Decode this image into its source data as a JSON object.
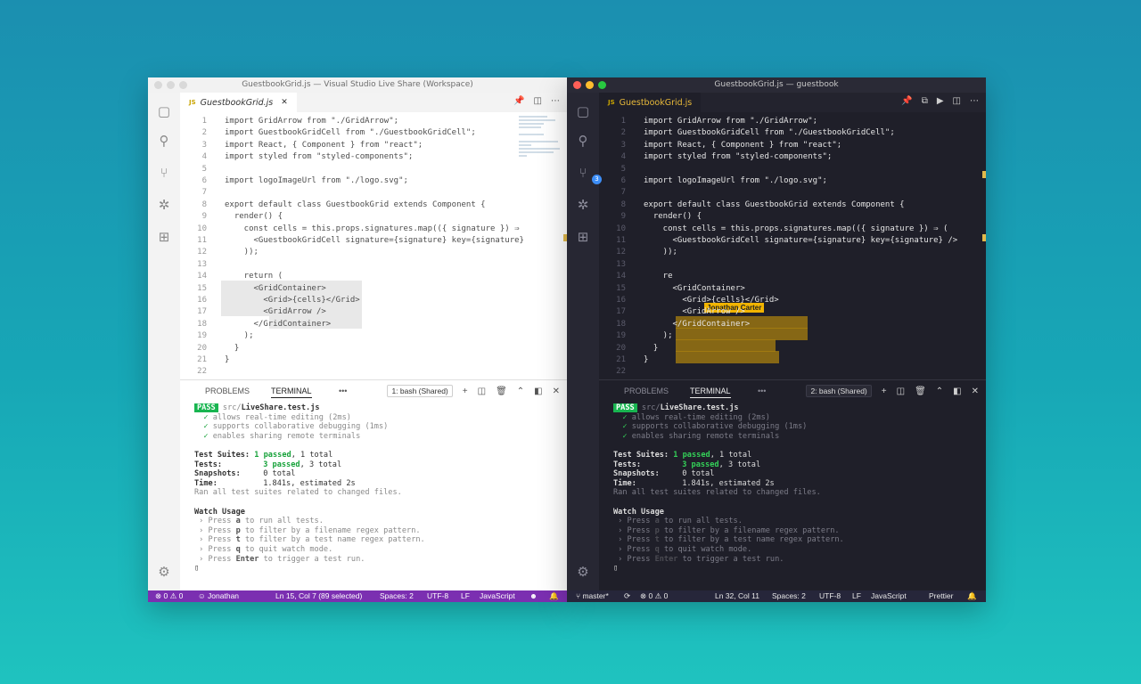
{
  "left": {
    "title": "GuestbookGrid.js — Visual Studio Live Share (Workspace)",
    "tab": {
      "icon": "JS",
      "label": "GuestbookGrid.js",
      "close": "✕"
    },
    "code": [
      {
        "n": "1",
        "t": "import GridArrow from \"./GridArrow\";"
      },
      {
        "n": "2",
        "t": "import GuestbookGridCell from \"./GuestbookGridCell\";"
      },
      {
        "n": "3",
        "t": "import React, { Component } from \"react\";"
      },
      {
        "n": "4",
        "t": "import styled from \"styled-components\";"
      },
      {
        "n": "5",
        "t": ""
      },
      {
        "n": "6",
        "t": "import logoImageUrl from \"./logo.svg\";"
      },
      {
        "n": "7",
        "t": ""
      },
      {
        "n": "8",
        "t": "export default class GuestbookGrid extends Component {"
      },
      {
        "n": "9",
        "t": "  render() {"
      },
      {
        "n": "10",
        "t": "    const cells = this.props.signatures.map(({ signature }) ⇒"
      },
      {
        "n": "11",
        "t": "      <GuestbookGridCell signature={signature} key={signature}"
      },
      {
        "n": "12",
        "t": "    ));"
      },
      {
        "n": "13",
        "t": ""
      },
      {
        "n": "14",
        "t": "    return ("
      },
      {
        "n": "15",
        "t": "      <GridContainer>"
      },
      {
        "n": "16",
        "t": "        <Grid>{cells}</Grid>"
      },
      {
        "n": "17",
        "t": "        <GridArrow />"
      },
      {
        "n": "18",
        "t": "      </GridContainer>"
      },
      {
        "n": "19",
        "t": "    );"
      },
      {
        "n": "20",
        "t": "  }"
      },
      {
        "n": "21",
        "t": "}"
      },
      {
        "n": "22",
        "t": ""
      }
    ],
    "panel": {
      "problems": "PROBLEMS",
      "terminal": "TERMINAL",
      "more": "•••",
      "select": "1: bash (Shared)"
    },
    "status": {
      "errors": "0",
      "warnings": "0",
      "user": "Jonathan",
      "position": "Ln 15, Col 7 (89 selected)",
      "spaces": "Spaces: 2",
      "encoding": "UTF-8",
      "eol": "LF",
      "language": "JavaScript"
    }
  },
  "right": {
    "title": "GuestbookGrid.js — guestbook",
    "tab": {
      "icon": "JS",
      "label": "GuestbookGrid.js"
    },
    "badge": "3",
    "collaborator": "Jonathan Carter",
    "code": [
      {
        "n": "1",
        "t": "import GridArrow from \"./GridArrow\";"
      },
      {
        "n": "2",
        "t": "import GuestbookGridCell from \"./GuestbookGridCell\";"
      },
      {
        "n": "3",
        "t": "import React, { Component } from \"react\";"
      },
      {
        "n": "4",
        "t": "import styled from \"styled-components\";"
      },
      {
        "n": "5",
        "t": ""
      },
      {
        "n": "6",
        "t": "import logoImageUrl from \"./logo.svg\";"
      },
      {
        "n": "7",
        "t": ""
      },
      {
        "n": "8",
        "t": "export default class GuestbookGrid extends Component {"
      },
      {
        "n": "9",
        "t": "  render() {"
      },
      {
        "n": "10",
        "t": "    const cells = this.props.signatures.map(({ signature }) ⇒ ("
      },
      {
        "n": "11",
        "t": "      <GuestbookGridCell signature={signature} key={signature} />"
      },
      {
        "n": "12",
        "t": "    ));"
      },
      {
        "n": "13",
        "t": ""
      },
      {
        "n": "14",
        "t": "    re"
      },
      {
        "n": "15",
        "t": "      <GridContainer>"
      },
      {
        "n": "16",
        "t": "        <Grid>{cells}</Grid>"
      },
      {
        "n": "17",
        "t": "        <GridArrow />"
      },
      {
        "n": "18",
        "t": "      </GridContainer>"
      },
      {
        "n": "19",
        "t": "    );"
      },
      {
        "n": "20",
        "t": "  }"
      },
      {
        "n": "21",
        "t": "}"
      },
      {
        "n": "22",
        "t": ""
      }
    ],
    "panel": {
      "problems": "PROBLEMS",
      "terminal": "TERMINAL",
      "more": "•••",
      "select": "2: bash (Shared)"
    },
    "status": {
      "branch": "master*",
      "errors": "0",
      "warnings": "0",
      "position": "Ln 32, Col 11",
      "spaces": "Spaces: 2",
      "encoding": "UTF-8",
      "eol": "LF",
      "language": "JavaScript",
      "formatter": "Prettier"
    }
  },
  "terminal": {
    "pass": "PASS",
    "file_dir": "src/",
    "file_name": "LiveShare.test.js",
    "tests": [
      "allows real-time editing (2ms)",
      "supports collaborative debugging (1ms)",
      "enables sharing remote terminals"
    ],
    "suites_label": "Test Suites:",
    "suites_pass": "1 passed",
    "suites_total": ", 1 total",
    "tests_label": "Tests:",
    "tests_pass": "3 passed",
    "tests_total": ", 3 total",
    "snap_label": "Snapshots:",
    "snap_val": "0 total",
    "time_label": "Time:",
    "time_val": "1.841s, estimated 2s",
    "ran": "Ran all test suites related to changed files.",
    "watch_title": "Watch Usage",
    "watch": [
      {
        "pre": " › Press ",
        "key": "a",
        "post": " to run all tests."
      },
      {
        "pre": " › Press ",
        "key": "p",
        "post": " to filter by a filename regex pattern."
      },
      {
        "pre": " › Press ",
        "key": "t",
        "post": " to filter by a test name regex pattern."
      },
      {
        "pre": " › Press ",
        "key": "q",
        "post": " to quit watch mode."
      },
      {
        "pre": " › Press ",
        "key": "Enter",
        "post": " to trigger a test run."
      }
    ],
    "cursor": "▯"
  },
  "colors": {
    "light_status": "#7b2fb1",
    "dark_status": "#26263a",
    "pass_green": "#18b550",
    "collab_yellow": "#f2b400"
  }
}
